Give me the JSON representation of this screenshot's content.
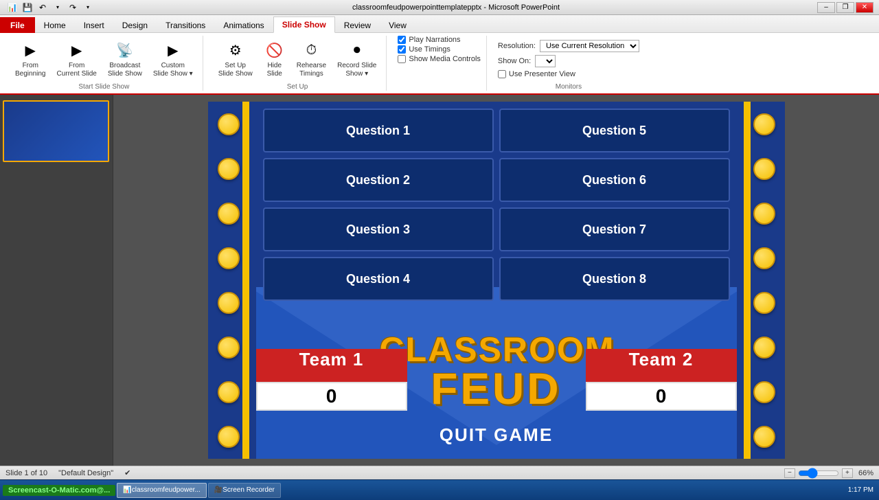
{
  "titlebar": {
    "title": "classroomfeudpowerpointtemplatepptx - Microsoft PowerPoint",
    "min": "–",
    "restore": "❐",
    "close": "✕"
  },
  "quickaccess": {
    "save": "💾",
    "undo": "↶",
    "redo": "↷",
    "dropdown": "▾"
  },
  "ribbontabs": [
    {
      "id": "file",
      "label": "File",
      "class": "file"
    },
    {
      "id": "home",
      "label": "Home"
    },
    {
      "id": "insert",
      "label": "Insert"
    },
    {
      "id": "design",
      "label": "Design"
    },
    {
      "id": "transitions",
      "label": "Transitions"
    },
    {
      "id": "animations",
      "label": "Animations"
    },
    {
      "id": "slideshow",
      "label": "Slide Show",
      "active": true
    },
    {
      "id": "review",
      "label": "Review"
    },
    {
      "id": "view",
      "label": "View"
    }
  ],
  "ribbon": {
    "groups": [
      {
        "id": "start-slideshow",
        "label": "Start Slide Show",
        "buttons": [
          {
            "id": "from-beginning",
            "icon": "▶",
            "label": "From\nBeginning"
          },
          {
            "id": "from-current",
            "icon": "▶",
            "label": "From\nCurrent Slide"
          },
          {
            "id": "broadcast",
            "icon": "📡",
            "label": "Broadcast\nSlide Show"
          },
          {
            "id": "custom",
            "icon": "▶",
            "label": "Custom\nSlide Show ▾"
          }
        ]
      },
      {
        "id": "setup",
        "label": "Set Up",
        "buttons": [
          {
            "id": "set-up-show",
            "icon": "⚙",
            "label": "Set Up\nSlide Show"
          },
          {
            "id": "hide-slide",
            "icon": "🚫",
            "label": "Hide\nSlide"
          },
          {
            "id": "rehearse-timings",
            "icon": "⏱",
            "label": "Rehearse\nTimings"
          },
          {
            "id": "record-slide-show",
            "icon": "⏺",
            "label": "Record Slide\nShow ▾"
          }
        ]
      }
    ],
    "playback": {
      "play_narrations": "Play Narrations",
      "use_timings": "Use Timings",
      "show_media_controls": "Show Media Controls"
    },
    "monitors": {
      "resolution_label": "Resolution:",
      "resolution_value": "Use Current Resolution",
      "show_on_label": "Show On:",
      "show_on_value": "",
      "presenter_view": "Use Presenter View",
      "section_label": "Monitors"
    }
  },
  "slide": {
    "questions": [
      {
        "id": "q1",
        "label": "Question 1"
      },
      {
        "id": "q2",
        "label": "Question 2"
      },
      {
        "id": "q3",
        "label": "Question 3"
      },
      {
        "id": "q4",
        "label": "Question 4"
      },
      {
        "id": "q5",
        "label": "Question 5"
      },
      {
        "id": "q6",
        "label": "Question 6"
      },
      {
        "id": "q7",
        "label": "Question 7"
      },
      {
        "id": "q8",
        "label": "Question 8"
      }
    ],
    "title_line1": "CLASSROOM",
    "title_line2": "FEUD",
    "team1": {
      "name": "Team 1",
      "score": "0"
    },
    "team2": {
      "name": "Team 2",
      "score": "0"
    },
    "quit_button": "QUIT GAME"
  },
  "statusbar": {
    "slide_info": "Slide 1 of 10",
    "theme": "\"Default Design\"",
    "check": "✔",
    "zoom": "66%",
    "zoom_minus": "−",
    "zoom_plus": "+"
  },
  "taskbar": {
    "start": "Screencast-O-Matic.com@...",
    "items": [
      {
        "id": "ppt",
        "label": "classroomfeudpower...",
        "active": true,
        "icon": "📊"
      },
      {
        "id": "recorder",
        "label": "Screen Recorder",
        "active": false,
        "icon": "🎥"
      }
    ],
    "time": "1:17 PM"
  }
}
